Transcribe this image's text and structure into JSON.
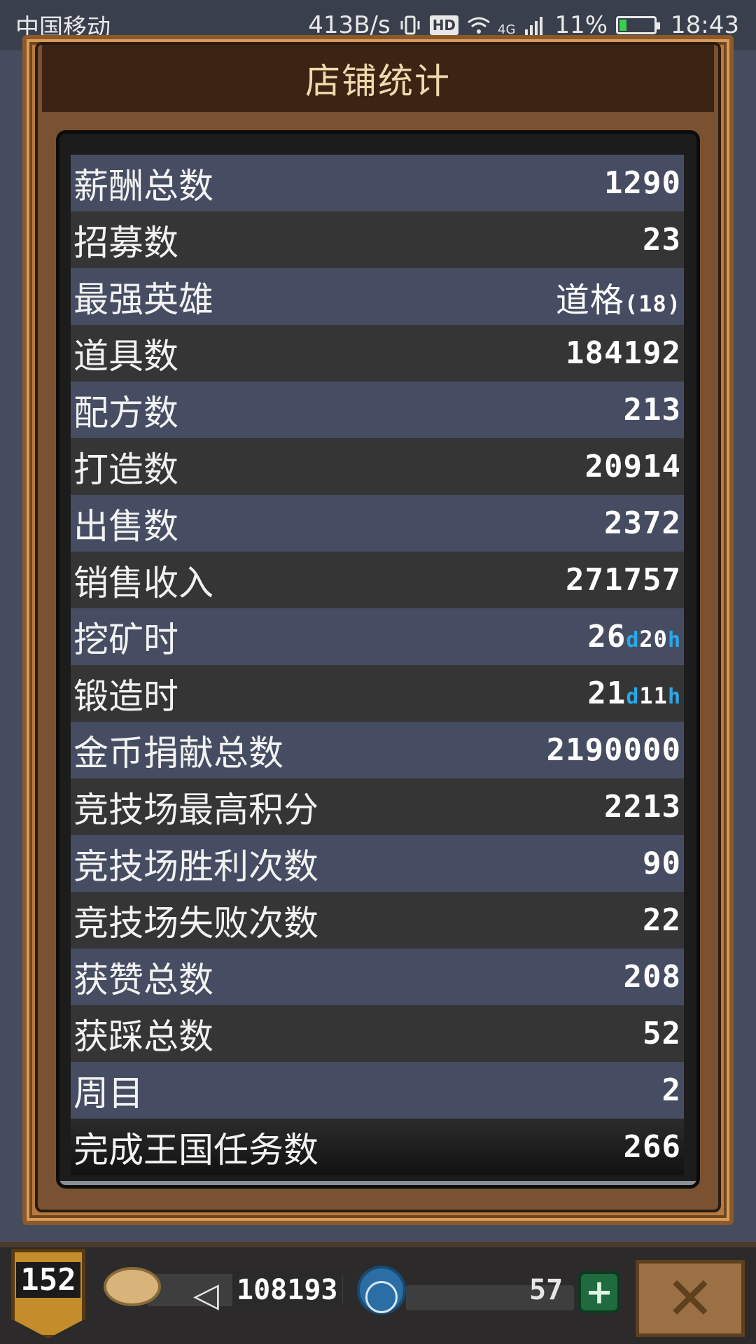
{
  "status_bar": {
    "carrier": "中国移动",
    "net_speed": "413B/s",
    "hd_badge": "HD",
    "network": "4G",
    "battery_percent": "11%",
    "time": "18:43"
  },
  "panel": {
    "title": "店铺统计"
  },
  "stats": [
    {
      "label": "薪酬总数",
      "value": "1290"
    },
    {
      "label": "招募数",
      "value": "23"
    },
    {
      "label": "最强英雄",
      "value_name": "道格",
      "value": "(18)"
    },
    {
      "label": "道具数",
      "value": "184192"
    },
    {
      "label": "配方数",
      "value": "213"
    },
    {
      "label": "打造数",
      "value": "20914"
    },
    {
      "label": "出售数",
      "value": "2372"
    },
    {
      "label": "销售收入",
      "value": "271757"
    },
    {
      "label": "挖矿时",
      "days": "26",
      "day_unit": "d",
      "hours": "20",
      "hour_unit": "h"
    },
    {
      "label": "锻造时",
      "days": "21",
      "day_unit": "d",
      "hours": "11",
      "hour_unit": "h"
    },
    {
      "label": "金币捐献总数",
      "value": "2190000"
    },
    {
      "label": "竞技场最高积分",
      "value": "2213"
    },
    {
      "label": "竞技场胜利次数",
      "value": "90"
    },
    {
      "label": "竞技场失败次数",
      "value": "22"
    },
    {
      "label": "获赞总数",
      "value": "208"
    },
    {
      "label": "获踩总数",
      "value": "52"
    },
    {
      "label": "周目",
      "value": "2"
    },
    {
      "label": "完成王国任务数",
      "value": "266"
    }
  ],
  "hud": {
    "level": "152",
    "gold": "108193",
    "gems": "57",
    "add_label": "+",
    "close_label": "✕"
  },
  "colors": {
    "row_light": "#464d62",
    "row_dark": "#353535",
    "title_bar": "#3b2414",
    "frame": "#d99a58",
    "time_unit": "#2aa8e8"
  }
}
